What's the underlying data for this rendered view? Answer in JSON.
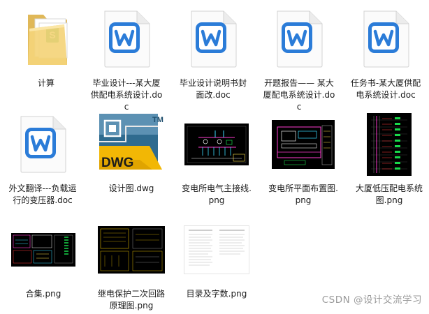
{
  "files": [
    {
      "name": "计算",
      "type": "folder"
    },
    {
      "name": "毕业设计---某大厦供配电系统设计.doc",
      "type": "word-doc"
    },
    {
      "name": "毕业设计说明书封面改.doc",
      "type": "word-doc"
    },
    {
      "name": "开题报告—— 某大厦配电系统设计.doc",
      "type": "word-doc"
    },
    {
      "name": "任务书-某大厦供配电系统设计.doc",
      "type": "word-doc"
    },
    {
      "name": "外文翻译---负载运行的变压器.doc",
      "type": "word-doc"
    },
    {
      "name": "设计图.dwg",
      "type": "dwg"
    },
    {
      "name": "变电所电气主接线.png",
      "type": "png"
    },
    {
      "name": "变电所平面布置图.png",
      "type": "png"
    },
    {
      "name": "大厦低压配电系统图.png",
      "type": "png"
    },
    {
      "name": "合集.png",
      "type": "png"
    },
    {
      "name": "继电保护二次回路原理图.png",
      "type": "png"
    },
    {
      "name": "目录及字数.png",
      "type": "png"
    }
  ],
  "icon_texts": {
    "dwg_badge": "DWG",
    "dwg_tm": "TM"
  },
  "watermark": "CSDN @设计交流学习",
  "colors": {
    "word_blue": "#2b7cd8",
    "dwg_yellow": "#f2b705",
    "dwg_teal": "#2f6b8f",
    "cad_green": "#19d84a"
  }
}
